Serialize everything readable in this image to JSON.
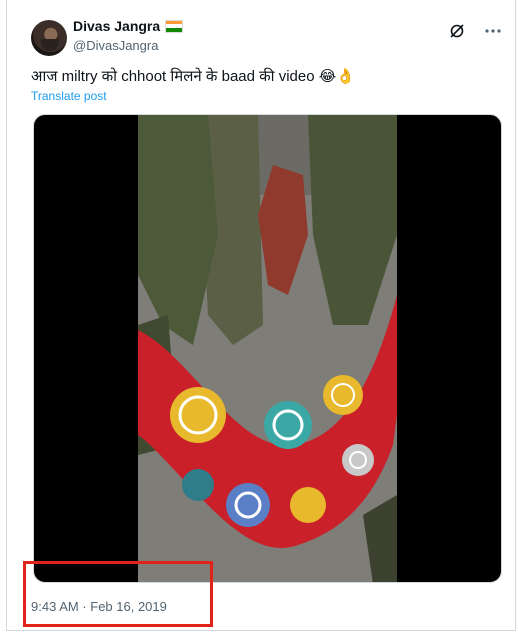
{
  "author": {
    "name": "Divas Jangra",
    "handle": "@DivasJangra",
    "flag_colors": [
      "#ff9933",
      "#ffffff",
      "#138808"
    ]
  },
  "icons": {
    "grok": "grok-icon",
    "more": "more-icon"
  },
  "tweet": {
    "text": "आज miltry को chhoot मिलने के baad की video",
    "emojis": "😂👌",
    "translate_label": "Translate post"
  },
  "media": {
    "type": "video",
    "colors": {
      "frame": "#000000",
      "uniform": "#4d5a3a",
      "blanket_red": "#c9202a",
      "blanket_yellow": "#e8b92c",
      "blanket_teal": "#3aa9a5"
    }
  },
  "timestamp": "9:43 AM · Feb 16, 2019",
  "highlight_color": "#e2231a"
}
